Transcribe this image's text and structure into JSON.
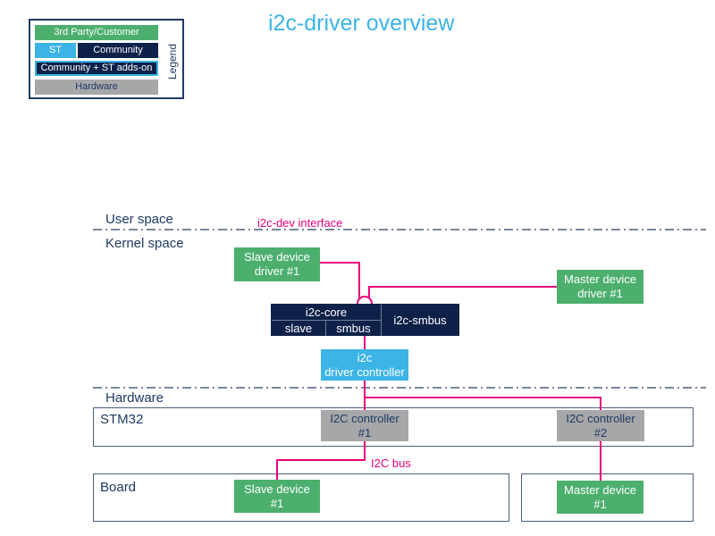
{
  "title": "i2c-driver overview",
  "legend": {
    "label": "Legend",
    "items": [
      {
        "label": "3rd Party/Customer",
        "color": "#4caf6e"
      },
      {
        "label": "ST",
        "color": "#3cb4e5"
      },
      {
        "label": "Community",
        "color": "#0d2149"
      },
      {
        "label": "Community + ST adds-on",
        "color": "#0d2149",
        "border": "#3cb4e5"
      },
      {
        "label": "Hardware",
        "color": "#a7a7a9"
      }
    ]
  },
  "sections": {
    "user_space": "User space",
    "kernel_space": "Kernel space",
    "hardware": "Hardware"
  },
  "annotations": {
    "i2c_dev_interface": "i2c-dev interface",
    "i2c_bus": "I2C bus"
  },
  "kernel": {
    "slave_driver": "Slave device\ndriver #1",
    "master_driver": "Master device\ndriver #1",
    "i2c_core": "i2c-core",
    "slave": "slave",
    "smbus": "smbus",
    "i2c_smbus": "i2c-smbus",
    "driver_controller": "i2c\ndriver controller"
  },
  "hardware": {
    "stm32_label": "STM32",
    "board_label": "Board",
    "controller1": "I2C controller\n#1",
    "controller2": "I2C controller\n#2",
    "slave_device": "Slave device\n#1",
    "master_device": "Master device\n#1"
  },
  "colors": {
    "link": "#e6007e",
    "title": "#3cb4e5",
    "divider": "#4b5f7f"
  }
}
